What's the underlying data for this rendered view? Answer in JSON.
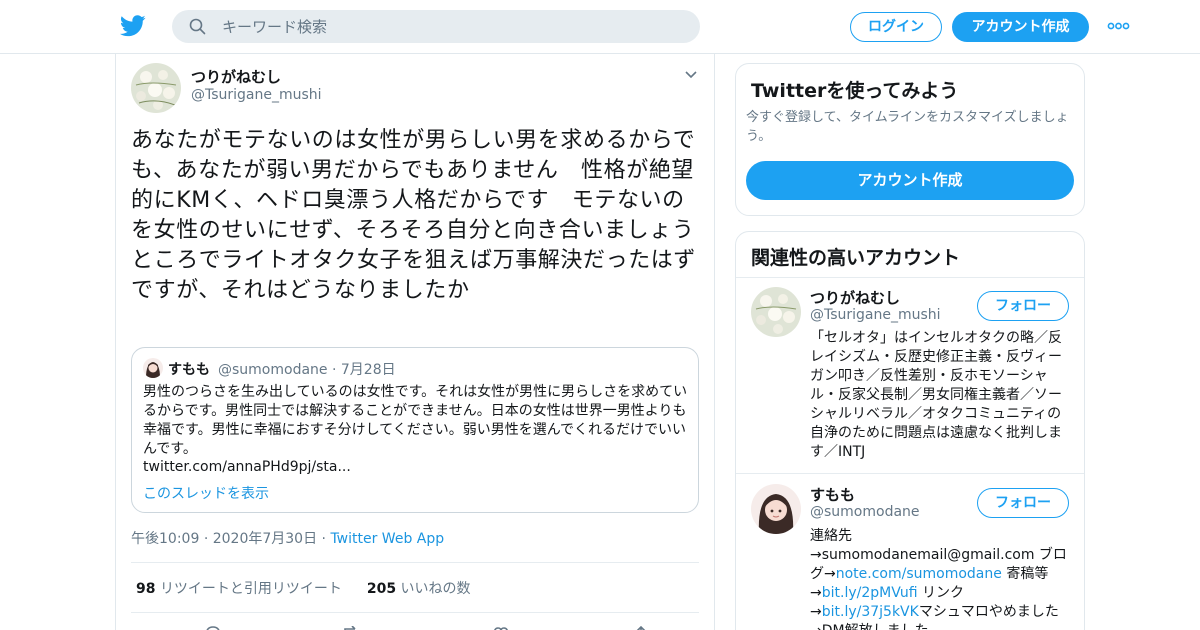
{
  "header": {
    "search_placeholder": "キーワード検索",
    "login_label": "ログイン",
    "signup_label": "アカウント作成"
  },
  "tweet": {
    "author_name": "つりがねむし",
    "author_handle": "@Tsurigane_mushi",
    "text": "あなたがモテないのは女性が男らしい男を求めるからでも、あなたが弱い男だからでもありません　性格が絶望的にKMく、ヘドロ臭漂う人格だからです　モテないのを女性のせいにせず、そろそろ自分と向き合いましょう　ところでライトオタク女子を狙えば万事解決だったはずですが、それはどうなりましたか",
    "quote": {
      "name": "すもも",
      "handle": "@sumomodane",
      "date": "7月28日",
      "text": "男性のつらさを生み出しているのは女性です。それは女性が男性に男らしさを求めているからです。男性同士では解決することができません。日本の女性は世界一男性よりも幸福です。男性に幸福におすそ分けしてください。弱い男性を選んでくれるだけでいいんです。",
      "url": "twitter.com/annaPHd9pj/sta...",
      "thread_label": "このスレッドを表示"
    },
    "time": "午後10:09",
    "date": "2020年7月30日",
    "app": "Twitter Web App",
    "retweets_count": "98",
    "retweets_label": "リツイートと引用リツイート",
    "likes_count": "205",
    "likes_label": "いいねの数"
  },
  "sidebar": {
    "promo": {
      "title": "Twitterを使ってみよう",
      "desc": "今すぐ登録して、タイムラインをカスタマイズしましょう。",
      "button": "アカウント作成"
    },
    "related": {
      "title": "関連性の高いアカウント",
      "follow_label": "フォロー",
      "accounts": [
        {
          "name": "つりがねむし",
          "handle": "@Tsurigane_mushi",
          "bio": "「セルオタ」はインセルオタクの略／反レイシズム・反歴史修正主義・反ヴィーガン叩き／反性差別・反ホモソーシャル・反家父長制／男女同権主義者／ソーシャルリベラル／オタクコミュニティの自浄のために問題点は遠慮なく批判します／INTJ"
        },
        {
          "name": "すもも",
          "handle": "@sumomodane",
          "bio_1": "連絡先",
          "bio_2": "→sumomodanemail@gmail.com ブログ→",
          "link_1": "note.com/sumomodane",
          "bio_3": " 寄稿等→",
          "link_2": "bit.ly/2pMVufi",
          "bio_4": " リンク→",
          "link_3": "bit.ly/37j5kVK",
          "bio_5": "マシュマロやめました→DM解放しました"
        }
      ]
    }
  },
  "colors": {
    "brand": "#1da1f2",
    "link": "#1b95e0",
    "muted": "#657786"
  }
}
